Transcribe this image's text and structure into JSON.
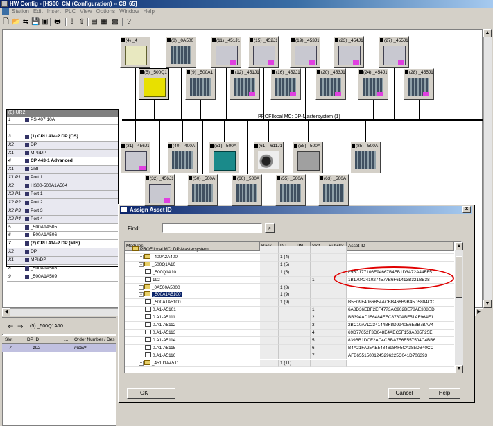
{
  "window": {
    "title": "HW Config - [HS00_CM (Configuration) -- C8_65]"
  },
  "menu": [
    "Station",
    "Edit",
    "Insert",
    "PLC",
    "View",
    "Options",
    "Window",
    "Help"
  ],
  "toolbar_icons": [
    "new-icon",
    "open-icon",
    "accessible-nodes-icon",
    "save-icon",
    "save-compile-icon",
    "print-icon",
    "download-icon",
    "upload-icon",
    "catalog-icon",
    "network-icon",
    "config-icon",
    "help-icon"
  ],
  "network": {
    "bus_label": "PROFIlocal MC: DP-Mastersystem (1)",
    "row1": [
      "(4) _4",
      "(8) _0A500",
      "(11) _451J1",
      "(15) _452J1",
      "(19) _453J1",
      "(23) _454J1",
      "(27) _455J1"
    ],
    "row2": [
      "(5) _500Q1",
      "(9) _500A1",
      "(12) _451J1",
      "(16) _452J1",
      "(20) _453J1",
      "(24) _454J1",
      "(28) _455J1"
    ],
    "row3": [
      "(31) _456J1",
      "(40) _400A",
      "(51) _500A",
      "(61) _611J1",
      "(58) _500A",
      "(85) _500A"
    ],
    "row4": [
      "(32) _456J1",
      "(50) _500A",
      "(60) _500A",
      "(55) _500A",
      "(63) _500A"
    ]
  },
  "rack": {
    "title": "(0) UR2",
    "rows": [
      {
        "slot": "1",
        "name": "PS 407 10A",
        "bold": false
      },
      {
        "slot": "",
        "name": "",
        "bold": false
      },
      {
        "slot": "3",
        "name": "(1) CPU 414-2 DP (CS)",
        "bold": true
      },
      {
        "slot": "X2",
        "name": "DP",
        "bold": false
      },
      {
        "slot": "X1",
        "name": "MPI/DP",
        "bold": false
      },
      {
        "slot": "4",
        "name": "CP 443-1 Advanced",
        "bold": true
      },
      {
        "slot": "X1",
        "name": "GBIT",
        "bold": false
      },
      {
        "slot": "X1 P1",
        "name": "Port 1",
        "bold": false
      },
      {
        "slot": "X2",
        "name": "HS00-500A1A504",
        "bold": false
      },
      {
        "slot": "X2 P1",
        "name": "Port 1",
        "bold": false
      },
      {
        "slot": "X2 P2",
        "name": "Port 2",
        "bold": false
      },
      {
        "slot": "X2 P3",
        "name": "Port 3",
        "bold": false
      },
      {
        "slot": "X2 P4",
        "name": "Port 4",
        "bold": false
      },
      {
        "slot": "5",
        "name": "_500A1A505",
        "bold": false
      },
      {
        "slot": "6",
        "name": "_500A1A506",
        "bold": false
      },
      {
        "slot": "7",
        "name": "(2) CPU 414-2 DP (MIS)",
        "bold": true
      },
      {
        "slot": "X2",
        "name": "DP",
        "bold": false
      },
      {
        "slot": "X1",
        "name": "MPI/DP",
        "bold": false
      },
      {
        "slot": "8",
        "name": "_500A1A508",
        "bold": false
      },
      {
        "slot": "9",
        "name": "_500A1A509",
        "bold": false
      }
    ]
  },
  "lower": {
    "title": "(5) _500Q1A10",
    "columns": [
      "Slot",
      "DP ID",
      "...",
      "Order Number / Des"
    ],
    "row": {
      "slot": "7",
      "dpid": "192",
      "order": "mcSP"
    }
  },
  "dialog": {
    "title": "Assign Asset ID",
    "find_label": "Find:",
    "find_value": "",
    "columns": [
      "Modules",
      "Rack",
      "DP",
      "PN",
      "Slot",
      "Subslot",
      "Asset ID"
    ],
    "rows": [
      {
        "indent": 1,
        "kind": "folder",
        "pm": "",
        "name": "PROFIlocal MC: DP-Mastersystem",
        "rack": "",
        "dp": "",
        "pn": "",
        "slot": "",
        "subslot": "",
        "asset": ""
      },
      {
        "indent": 2,
        "kind": "folder",
        "pm": "+",
        "name": "_400A2A400",
        "rack": "",
        "dp": "1 (4)",
        "pn": "",
        "slot": "",
        "subslot": "",
        "asset": ""
      },
      {
        "indent": 2,
        "kind": "folder",
        "pm": "-",
        "name": "_500Q1A10",
        "rack": "",
        "dp": "1 (5)",
        "pn": "",
        "slot": "",
        "subslot": "",
        "asset": ""
      },
      {
        "indent": 3,
        "kind": "mod",
        "pm": "",
        "name": "_500Q1A10",
        "rack": "",
        "dp": "1 (5)",
        "pn": "",
        "slot": "",
        "subslot": "",
        "asset": "F95C177106E94667B4FB1D3A72A44FF5"
      },
      {
        "indent": 3,
        "kind": "mod",
        "pm": "",
        "name": "192",
        "rack": "",
        "dp": "",
        "pn": "",
        "slot": "1",
        "subslot": "",
        "asset": "1B17042410274577B6F61413B321BB38"
      },
      {
        "indent": 2,
        "kind": "folder",
        "pm": "+",
        "name": "_0A500A5000",
        "rack": "",
        "dp": "1 (8)",
        "pn": "",
        "slot": "",
        "subslot": "",
        "asset": ""
      },
      {
        "indent": 2,
        "kind": "folder",
        "pm": "-",
        "name": "_500A1A5100",
        "rack": "",
        "dp": "1 (9)",
        "pn": "",
        "slot": "",
        "subslot": "",
        "asset": "",
        "selected": true
      },
      {
        "indent": 3,
        "kind": "mod",
        "pm": "",
        "name": "_500A1A5100",
        "rack": "",
        "dp": "1 (9)",
        "pn": "",
        "slot": "",
        "subslot": "",
        "asset": "B5E09F4066B54ACBB466B9B45D5804CC"
      },
      {
        "indent": 3,
        "kind": "mod",
        "pm": "",
        "name": "0.A1-A5101",
        "rack": "",
        "dp": "",
        "pn": "",
        "slot": "1",
        "subslot": "",
        "asset": "6A8D36EBF2EF4773AC902BE78AE308ED"
      },
      {
        "indent": 3,
        "kind": "mod",
        "pm": "",
        "name": "0.A1-A5111",
        "rack": "",
        "dp": "",
        "pn": "",
        "slot": "2",
        "subslot": "",
        "asset": "BB394AD156484EEC8760ABF51AF964E1"
      },
      {
        "indent": 3,
        "kind": "mod",
        "pm": "",
        "name": "0.A1-A5112",
        "rack": "",
        "dp": "",
        "pn": "",
        "slot": "3",
        "subslot": "",
        "asset": "2BC10A7D234144BF8D9940E6E3B7BA74"
      },
      {
        "indent": 3,
        "kind": "mod",
        "pm": "",
        "name": "0.A1-A5113",
        "rack": "",
        "dp": "",
        "pn": "",
        "slot": "4",
        "subslot": "",
        "asset": "69D77652F3D048E4AEC5F153A085F25E"
      },
      {
        "indent": 3,
        "kind": "mod",
        "pm": "",
        "name": "0.A1-A5114",
        "rack": "",
        "dp": "",
        "pn": "",
        "slot": "5",
        "subslot": "",
        "asset": "839BB1DCF2AC4CBBA7F6E557504C4BB6"
      },
      {
        "indent": 3,
        "kind": "mod",
        "pm": "",
        "name": "0.A1-A5115",
        "rack": "",
        "dp": "",
        "pn": "",
        "slot": "6",
        "subslot": "",
        "asset": "B4A21FA25AE54846984F5CA385DB40CC"
      },
      {
        "indent": 3,
        "kind": "mod",
        "pm": "",
        "name": "0.A1-A5116",
        "rack": "",
        "dp": "",
        "pn": "",
        "slot": "7",
        "subslot": "",
        "asset": "AFB65515001245296225C041D706393"
      },
      {
        "indent": 2,
        "kind": "folder",
        "pm": "+",
        "name": "_451J1A4511",
        "rack": "",
        "dp": "1 (11)",
        "pn": "",
        "slot": "",
        "subslot": "",
        "asset": ""
      }
    ],
    "ok_label": "OK",
    "cancel_label": "Cancel",
    "help_label": "Help"
  }
}
